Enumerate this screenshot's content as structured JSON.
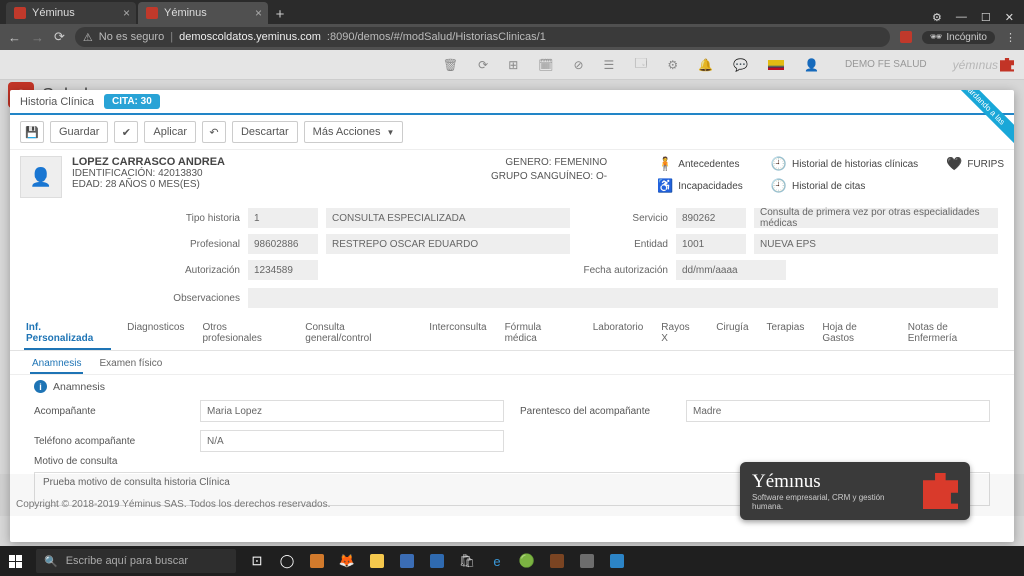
{
  "browser": {
    "tabs": [
      {
        "title": "Yéminus",
        "active": false
      },
      {
        "title": "Yéminus",
        "active": true
      }
    ],
    "insecure_label": "No es seguro",
    "url_host": "demoscoldatos.yeminus.com",
    "url_path": ":8090/demos/#/modSalud/HistoriasClinicas/1",
    "incognito_label": "Incógnito"
  },
  "app": {
    "topbar_user": "DEMO FE SALUD",
    "brand": "yémınus",
    "crumb_app": "Salud",
    "crumb_section": "Historia Clínica"
  },
  "modal": {
    "title": "Historia Clínica",
    "cita_badge": "CITA: 30",
    "ribbon": "Guardando a las"
  },
  "toolbar": {
    "guardar": "Guardar",
    "aplicar": "Aplicar",
    "descartar": "Descartar",
    "mas_acciones": "Más Acciones"
  },
  "patient": {
    "name": "LOPEZ CARRASCO ANDREA",
    "ident_label": "IDENTIFICACIÓN:",
    "ident_value": "42013830",
    "edad_label": "EDAD:",
    "edad_value": "28 AÑOS 0 MES(ES)",
    "genero_label": "GENERO:",
    "genero_value": "FEMENINO",
    "grupo_label": "GRUPO SANGUÍNEO:",
    "grupo_value": "O-"
  },
  "patient_links": {
    "antecedentes": "Antecedentes",
    "incapacidades": "Incapacidades",
    "hist_hist": "Historial de historias clínicas",
    "hist_citas": "Historial de citas",
    "furips": "FURIPS"
  },
  "form": {
    "tipo_label": "Tipo historia",
    "tipo_code": "1",
    "tipo_desc": "CONSULTA ESPECIALIZADA",
    "servicio_label": "Servicio",
    "servicio_code": "890262",
    "servicio_desc": "Consulta de primera vez por otras especialidades médicas",
    "prof_label": "Profesional",
    "prof_code": "98602886",
    "prof_desc": "RESTREPO  OSCAR EDUARDO",
    "entidad_label": "Entidad",
    "entidad_code": "1001",
    "entidad_desc": "NUEVA EPS",
    "autorizacion_label": "Autorización",
    "autorizacion_value": "1234589",
    "fecha_aut_label": "Fecha autorización",
    "fecha_aut_value": "dd/mm/aaaa",
    "obs_label": "Observaciones"
  },
  "tabs": {
    "items": [
      "Inf. Personalizada",
      "Diagnosticos",
      "Otros profesionales",
      "Consulta general/control",
      "Interconsulta",
      "Fórmula médica",
      "Laboratorio",
      "Rayos X",
      "Cirugía",
      "Terapias",
      "Hoja de Gastos",
      "Notas de Enfermería"
    ],
    "active_index": 0
  },
  "subtabs": {
    "items": [
      "Anamnesis",
      "Examen físico"
    ],
    "active_index": 0
  },
  "section": {
    "title": "Anamnesis"
  },
  "body": {
    "acomp_label": "Acompañante",
    "acomp_value": "Maria Lopez",
    "parent_label": "Parentesco del acompañante",
    "parent_value": "Madre",
    "tel_label": "Teléfono acompañante",
    "tel_value": "N/A",
    "motivo_label": "Motivo de consulta",
    "motivo_value": "Prueba motivo de consulta historia Clínica"
  },
  "footer": {
    "copyright": "Copyright © 2018-2019 Yéminus SAS. Todos los derechos reservados."
  },
  "brandbox": {
    "name": "Yémınus",
    "tagline": "Software empresarial, CRM y gestión humana."
  },
  "taskbar": {
    "search_placeholder": "Escribe aquí para buscar"
  }
}
